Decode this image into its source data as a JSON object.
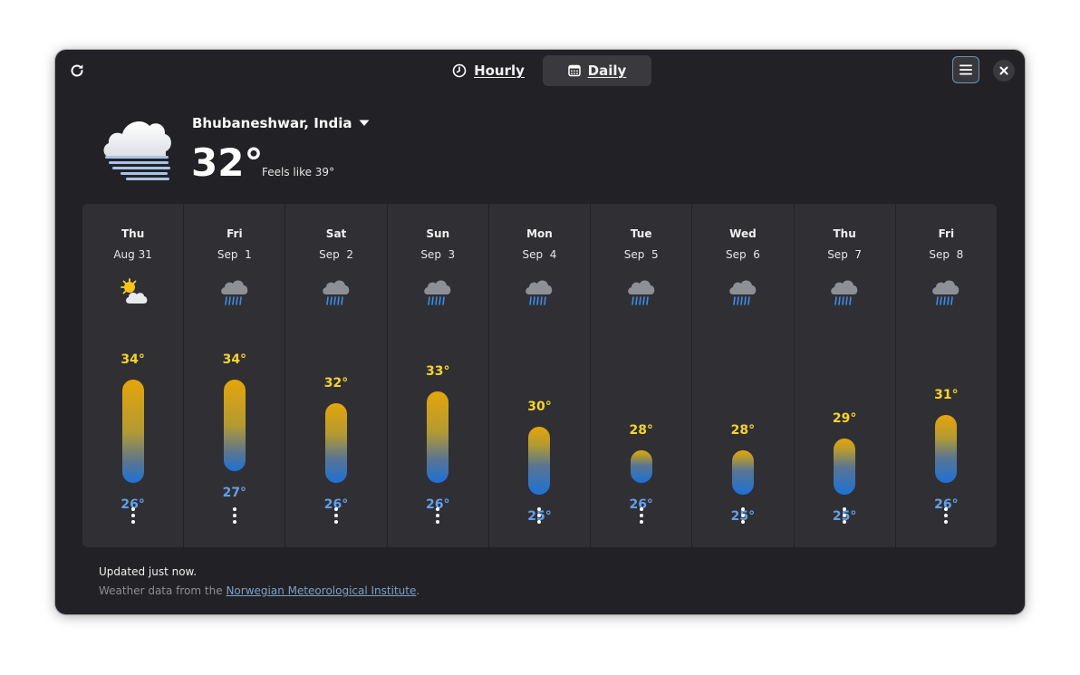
{
  "header": {
    "tabs": [
      {
        "label": "Hourly",
        "active": false,
        "icon": "clock-icon"
      },
      {
        "label": "Daily",
        "active": true,
        "icon": "calendar-icon"
      }
    ]
  },
  "current": {
    "location": "Bhubaneshwar, India",
    "temperature": "32°",
    "feels_like": "Feels like 39°",
    "icon": "fog-cloud-icon"
  },
  "forecast": [
    {
      "day": "Thu",
      "date": "Aug 31",
      "high": "34°",
      "low": "26°",
      "high_val": 34,
      "low_val": 26,
      "icon": "sun-behind-cloud-icon"
    },
    {
      "day": "Fri",
      "date": "Sep  1",
      "high": "34°",
      "low": "27°",
      "high_val": 34,
      "low_val": 27,
      "icon": "rain-cloud-icon"
    },
    {
      "day": "Sat",
      "date": "Sep  2",
      "high": "32°",
      "low": "26°",
      "high_val": 32,
      "low_val": 26,
      "icon": "rain-cloud-icon"
    },
    {
      "day": "Sun",
      "date": "Sep  3",
      "high": "33°",
      "low": "26°",
      "high_val": 33,
      "low_val": 26,
      "icon": "rain-cloud-icon"
    },
    {
      "day": "Mon",
      "date": "Sep  4",
      "high": "30°",
      "low": "25°",
      "high_val": 30,
      "low_val": 25,
      "icon": "rain-cloud-icon"
    },
    {
      "day": "Tue",
      "date": "Sep  5",
      "high": "28°",
      "low": "26°",
      "high_val": 28,
      "low_val": 26,
      "icon": "rain-cloud-icon"
    },
    {
      "day": "Wed",
      "date": "Sep  6",
      "high": "28°",
      "low": "25°",
      "high_val": 28,
      "low_val": 25,
      "icon": "rain-cloud-icon"
    },
    {
      "day": "Thu",
      "date": "Sep  7",
      "high": "29°",
      "low": "25°",
      "high_val": 29,
      "low_val": 25,
      "icon": "rain-cloud-icon"
    },
    {
      "day": "Fri",
      "date": "Sep  8",
      "high": "31°",
      "low": "26°",
      "high_val": 31,
      "low_val": 26,
      "icon": "rain-cloud-icon"
    }
  ],
  "footer": {
    "updated": "Updated just now.",
    "source_prefix": "Weather data from the ",
    "source_link": "Norwegian Meteorological Institute",
    "source_suffix": "."
  },
  "colors": {
    "high": "#f6d32d",
    "low": "#62a0ea",
    "bar_warm": "#e5a50a",
    "bar_cool": "#1c71d8"
  }
}
